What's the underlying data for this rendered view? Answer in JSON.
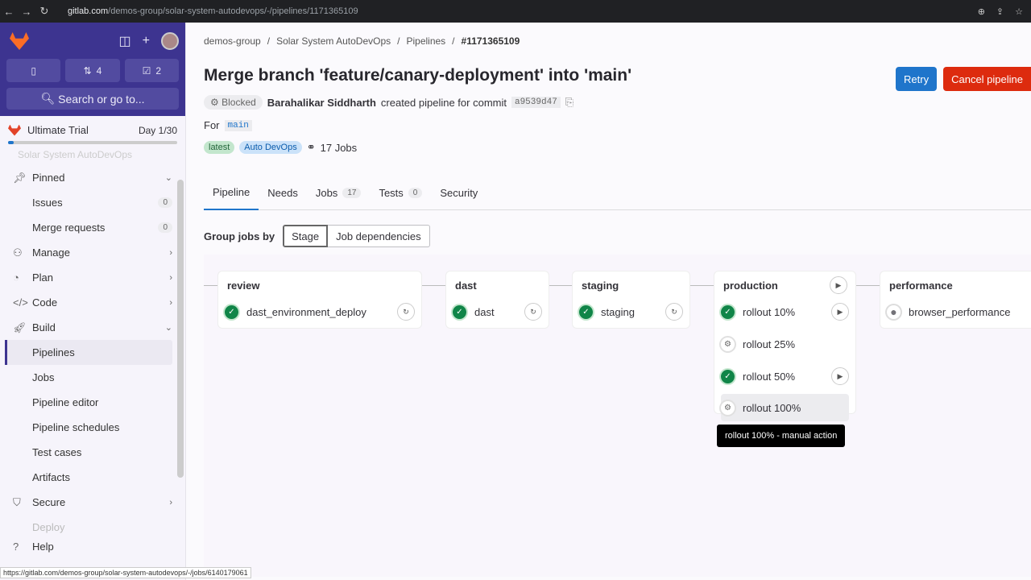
{
  "browser": {
    "url_host": "gitlab.com",
    "url_path": "/demos-group/solar-system-autodevops/-/pipelines/1171365109",
    "status_url": "https://gitlab.com/demos-group/solar-system-autodevops/-/jobs/6140179061"
  },
  "sidebar": {
    "mr_count": "4",
    "todo_count": "2",
    "search": "Search or go to...",
    "trial": "Ultimate Trial",
    "trial_day": "Day 1/30",
    "trial_progress": 0.033,
    "project": "Solar System AutoDevOps",
    "pinned": "Pinned",
    "issues": "Issues",
    "issues_count": "0",
    "mrs": "Merge requests",
    "mrs_count": "0",
    "manage": "Manage",
    "plan": "Plan",
    "code": "Code",
    "build": "Build",
    "build_items": [
      "Pipelines",
      "Jobs",
      "Pipeline editor",
      "Pipeline schedules",
      "Test cases",
      "Artifacts"
    ],
    "secure": "Secure",
    "deploy": "Deploy",
    "help": "Help"
  },
  "breadcrumb": [
    "demos-group",
    "Solar System AutoDevOps",
    "Pipelines",
    "#1171365109"
  ],
  "header": {
    "title": "Merge branch 'feature/canary-deployment' into 'main'",
    "retry": "Retry",
    "cancel": "Cancel pipeline",
    "status": "Blocked",
    "author": "Barahalikar Siddharth",
    "created_text": "created pipeline for commit",
    "commit": "a9539d47",
    "for_label": "For",
    "branch": "main",
    "tag_latest": "latest",
    "tag_autodevops": "Auto DevOps",
    "jobs_text": "17 Jobs"
  },
  "tabs": [
    {
      "label": "Pipeline"
    },
    {
      "label": "Needs"
    },
    {
      "label": "Jobs",
      "count": "17"
    },
    {
      "label": "Tests",
      "count": "0"
    },
    {
      "label": "Security"
    }
  ],
  "group": {
    "label": "Group jobs by",
    "stage": "Stage",
    "deps": "Job dependencies"
  },
  "stages": {
    "review": {
      "name": "review",
      "job": "dast_environment_deploy"
    },
    "dast": {
      "name": "dast",
      "job": "dast"
    },
    "staging": {
      "name": "staging",
      "job": "staging"
    },
    "production": {
      "name": "production",
      "jobs": [
        "rollout 10%",
        "rollout 25%",
        "rollout 50%",
        "rollout 100%"
      ]
    },
    "performance": {
      "name": "performance",
      "job": "browser_performance"
    }
  },
  "tooltip": "rollout 100% - manual action",
  "colors": {
    "sidebar": "#3d3490",
    "retry": "#1f75cb",
    "cancel": "#dd2b0e",
    "success": "#108548"
  }
}
